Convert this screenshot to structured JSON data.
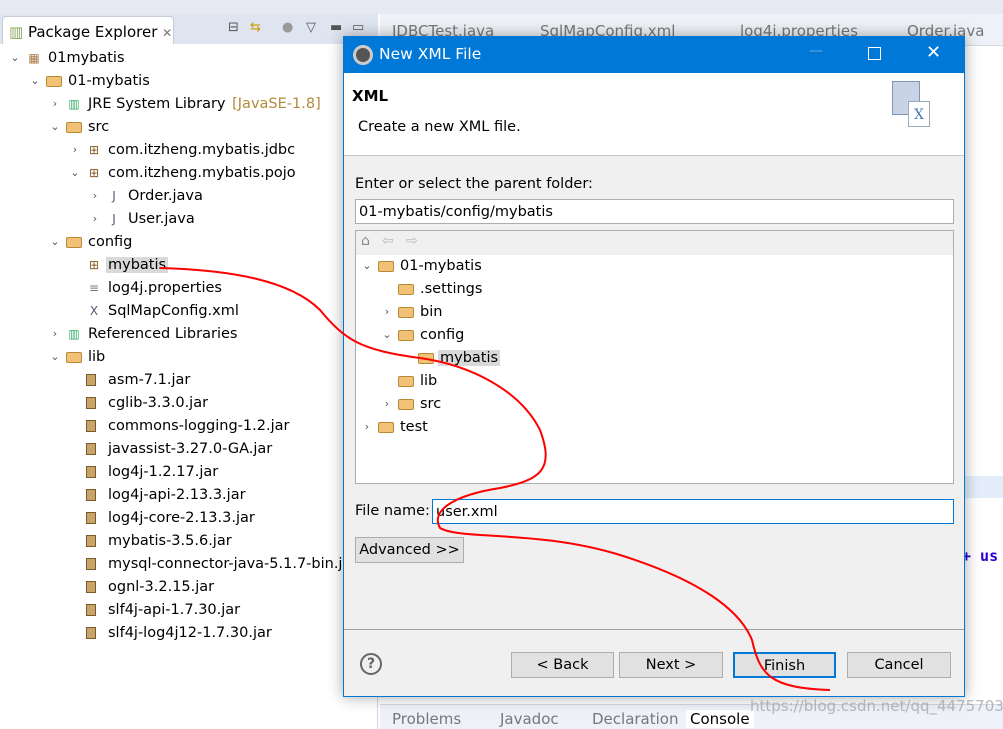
{
  "package_explorer": {
    "title": "Package Explorer",
    "tree": [
      {
        "label": "01mybatis",
        "level": 0,
        "state": "expanded",
        "icon": "working-set-icon"
      },
      {
        "label": "01-mybatis",
        "level": 1,
        "state": "expanded",
        "icon": "project-icon"
      },
      {
        "label": "JRE System Library",
        "decoration": "[JavaSE-1.8]",
        "level": 2,
        "state": "collapsed",
        "icon": "library-icon"
      },
      {
        "label": "src",
        "level": 2,
        "state": "expanded",
        "icon": "source-folder-icon"
      },
      {
        "label": "com.itzheng.mybatis.jdbc",
        "level": 3,
        "state": "collapsed",
        "icon": "package-icon"
      },
      {
        "label": "com.itzheng.mybatis.pojo",
        "level": 3,
        "state": "expanded",
        "icon": "package-icon"
      },
      {
        "label": "Order.java",
        "level": 4,
        "state": "collapsed",
        "icon": "java-file-icon"
      },
      {
        "label": "User.java",
        "level": 4,
        "state": "collapsed",
        "icon": "java-file-icon"
      },
      {
        "label": "config",
        "level": 2,
        "state": "expanded",
        "icon": "source-folder-icon"
      },
      {
        "label": "mybatis",
        "level": 3,
        "state": "leaf",
        "icon": "package-icon",
        "selected": true
      },
      {
        "label": "log4j.properties",
        "level": 3,
        "state": "leaf",
        "icon": "text-file-icon"
      },
      {
        "label": "SqlMapConfig.xml",
        "level": 3,
        "state": "leaf",
        "icon": "xml-file-icon"
      },
      {
        "label": "Referenced Libraries",
        "level": 2,
        "state": "collapsed",
        "icon": "library-icon"
      },
      {
        "label": "lib",
        "level": 2,
        "state": "expanded",
        "icon": "folder-icon"
      },
      {
        "label": "asm-7.1.jar",
        "level": 3,
        "state": "leaf",
        "icon": "jar-icon"
      },
      {
        "label": "cglib-3.3.0.jar",
        "level": 3,
        "state": "leaf",
        "icon": "jar-icon"
      },
      {
        "label": "commons-logging-1.2.jar",
        "level": 3,
        "state": "leaf",
        "icon": "jar-icon"
      },
      {
        "label": "javassist-3.27.0-GA.jar",
        "level": 3,
        "state": "leaf",
        "icon": "jar-icon"
      },
      {
        "label": "log4j-1.2.17.jar",
        "level": 3,
        "state": "leaf",
        "icon": "jar-icon"
      },
      {
        "label": "log4j-api-2.13.3.jar",
        "level": 3,
        "state": "leaf",
        "icon": "jar-icon"
      },
      {
        "label": "log4j-core-2.13.3.jar",
        "level": 3,
        "state": "leaf",
        "icon": "jar-icon"
      },
      {
        "label": "mybatis-3.5.6.jar",
        "level": 3,
        "state": "leaf",
        "icon": "jar-icon"
      },
      {
        "label": "mysql-connector-java-5.1.7-bin.jar",
        "level": 3,
        "state": "leaf",
        "icon": "jar-icon"
      },
      {
        "label": "ognl-3.2.15.jar",
        "level": 3,
        "state": "leaf",
        "icon": "jar-icon"
      },
      {
        "label": "slf4j-api-1.7.30.jar",
        "level": 3,
        "state": "leaf",
        "icon": "jar-icon"
      },
      {
        "label": "slf4j-log4j12-1.7.30.jar",
        "level": 3,
        "state": "leaf",
        "icon": "jar-icon"
      }
    ]
  },
  "editor": {
    "tabs": [
      "JDBCTest.java",
      "SqlMapConfig.xml",
      "log4j.properties",
      "Order.java"
    ],
    "code_fragment": "+ us"
  },
  "bottom_panel": {
    "tabs": [
      "Problems",
      "Javadoc",
      "Declaration",
      "Console"
    ],
    "active": "Console"
  },
  "watermark": "https://blog.csdn.net/qq_44757034",
  "dialog": {
    "title": "New XML File",
    "header_title": "XML",
    "header_desc": "Create a new XML file.",
    "parent_label": "Enter or select the parent folder:",
    "parent_value": "01-mybatis/config/mybatis",
    "folder_tree": [
      {
        "label": "01-mybatis",
        "level": 0,
        "state": "expanded",
        "icon": "project-icon"
      },
      {
        "label": ".settings",
        "level": 1,
        "state": "leaf",
        "icon": "folder-icon"
      },
      {
        "label": "bin",
        "level": 1,
        "state": "collapsed",
        "icon": "folder-icon"
      },
      {
        "label": "config",
        "level": 1,
        "state": "expanded",
        "icon": "folder-icon"
      },
      {
        "label": "mybatis",
        "level": 2,
        "state": "leaf",
        "icon": "folder-icon",
        "selected": true
      },
      {
        "label": "lib",
        "level": 1,
        "state": "leaf",
        "icon": "folder-icon"
      },
      {
        "label": "src",
        "level": 1,
        "state": "collapsed",
        "icon": "folder-icon"
      },
      {
        "label": "test",
        "level": 0,
        "state": "collapsed",
        "icon": "project-icon"
      }
    ],
    "file_name_label": "File name:",
    "file_name_value": "user.xml",
    "advanced": "Advanced >>",
    "back": "< Back",
    "next": "Next >",
    "finish": "Finish",
    "cancel": "Cancel"
  },
  "colors": {
    "title_bar": "#0078d7",
    "annotation_stroke": "#ff0000"
  }
}
